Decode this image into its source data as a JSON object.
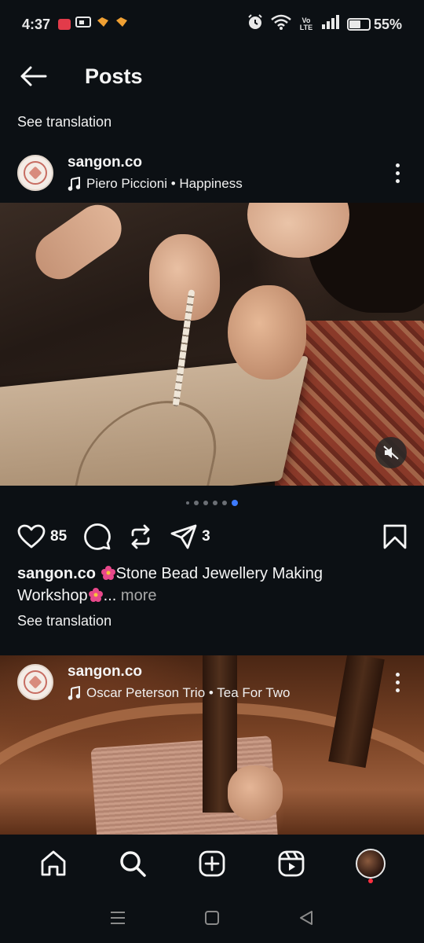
{
  "status_bar": {
    "time": "4:37",
    "battery": "55%",
    "network_label": "Vo LTE"
  },
  "header": {
    "title": "Posts"
  },
  "top_translation": "See translation",
  "post1": {
    "username": "sangon.co",
    "music": "Piero Piccioni • Happiness",
    "carousel": {
      "count": 6,
      "active_index": 5
    },
    "likes": "85",
    "shares": "3",
    "caption": {
      "username": "sangon.co",
      "text_part1": "Stone Bead Jewellery Making",
      "text_part2": "Workshop",
      "ellipsis": "...",
      "more": "more"
    },
    "translation": "See translation"
  },
  "post2": {
    "username": "sangon.co",
    "music": "Oscar Peterson Trio • Tea For Two"
  },
  "colors": {
    "background": "#0c1014",
    "carousel_active": "#3d7bff",
    "notification_dot": "#ff3040",
    "emoji_hibiscus": "#e8488a"
  },
  "icons": {
    "emoji": "hibiscus"
  }
}
